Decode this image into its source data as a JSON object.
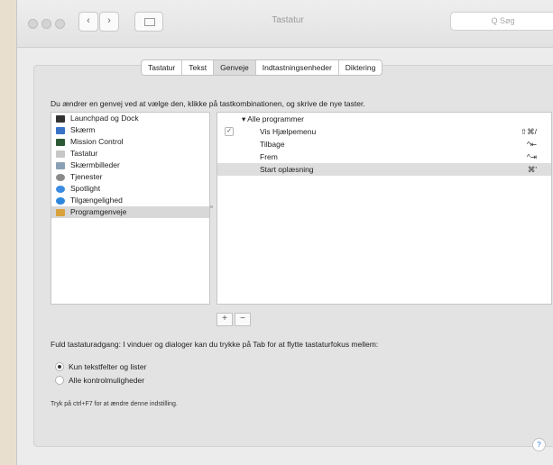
{
  "window": {
    "title": "Tastatur",
    "search_placeholder": "Q Søg"
  },
  "tabs": [
    {
      "label": "Tastatur"
    },
    {
      "label": "Tekst"
    },
    {
      "label": "Genveje"
    },
    {
      "label": "Indtastningsenheder"
    },
    {
      "label": "Diktering"
    }
  ],
  "active_tab": "Genveje",
  "description": "Du ændrer en genvej ved at vælge den, klikke på tastkombinationen, og skrive de nye taster.",
  "categories": [
    {
      "label": "Launchpad og Dock",
      "icon": "launchpad-icon",
      "color": "#333333"
    },
    {
      "label": "Skærm",
      "icon": "display-icon",
      "color": "#3a73c6"
    },
    {
      "label": "Mission Control",
      "icon": "mission-control-icon",
      "color": "#2d5a36"
    },
    {
      "label": "Tastatur",
      "icon": "keyboard-icon",
      "color": "#c7c7c7"
    },
    {
      "label": "Skærmbilleder",
      "icon": "screenshot-icon",
      "color": "#8aa1b5"
    },
    {
      "label": "Tjenester",
      "icon": "gear-icon",
      "color": "#8a8a8a"
    },
    {
      "label": "Spotlight",
      "icon": "spotlight-icon",
      "color": "#3b8be3"
    },
    {
      "label": "Tilgængelighed",
      "icon": "accessibility-icon",
      "color": "#2c86de"
    },
    {
      "label": "Programgenveje",
      "icon": "app-shortcuts-icon",
      "color": "#d9a23a"
    }
  ],
  "selected_category": "Programgenveje",
  "shortcuts": {
    "group": "▾ Alle programmer",
    "rows": [
      {
        "label": "Vis Hjælpemenu",
        "key": "⇧⌘/",
        "checked": true
      },
      {
        "label": "Tilbage",
        "key": "^⇤"
      },
      {
        "label": "Frem",
        "key": "^⇥"
      },
      {
        "label": "Start oplæsning",
        "key": "⌘'",
        "selected": true
      }
    ]
  },
  "buttons": {
    "add": "+",
    "remove": "−",
    "help": "?"
  },
  "full_access": {
    "text": "Fuld tastaturadgang: I vinduer og dialoger kan du trykke på Tab for at flytte tastaturfokus mellem:",
    "options": [
      {
        "label": "Kun tekstfelter og lister",
        "selected": true
      },
      {
        "label": "Alle kontrolmuligheder",
        "selected": false
      }
    ],
    "hint": "Tryk på ctrl+F7 for at ændre denne indstilling."
  }
}
